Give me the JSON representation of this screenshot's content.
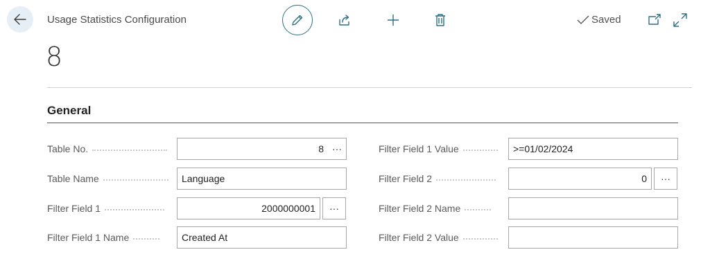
{
  "header": {
    "caption": "Usage Statistics Configuration",
    "saved_label": "Saved",
    "record_title": "8"
  },
  "toolbar": {
    "icons": [
      "back-arrow-icon",
      "pencil-icon",
      "share-icon",
      "plus-icon",
      "trash-icon",
      "checkmark-icon",
      "open-in-new-window-icon",
      "expand-icon"
    ]
  },
  "section": {
    "title": "General"
  },
  "fields": {
    "table_no": {
      "label": "Table No.",
      "value": "8"
    },
    "table_name": {
      "label": "Table Name",
      "value": "Language"
    },
    "filter_field_1": {
      "label": "Filter Field 1",
      "value": "2000000001"
    },
    "filter_field_1_name": {
      "label": "Filter Field 1 Name",
      "value": "Created At"
    },
    "filter_field_1_value": {
      "label": "Filter Field 1 Value",
      "value": ">=01/02/2024"
    },
    "filter_field_2": {
      "label": "Filter Field 2",
      "value": "0"
    },
    "filter_field_2_name": {
      "label": "Filter Field 2 Name",
      "value": ""
    },
    "filter_field_2_value": {
      "label": "Filter Field 2 Value",
      "value": ""
    },
    "lookup_glyph": "···"
  },
  "colors": {
    "accent": "#2b6f85",
    "back_bg": "#e6eef6",
    "input_border": "#a6a6a6"
  }
}
